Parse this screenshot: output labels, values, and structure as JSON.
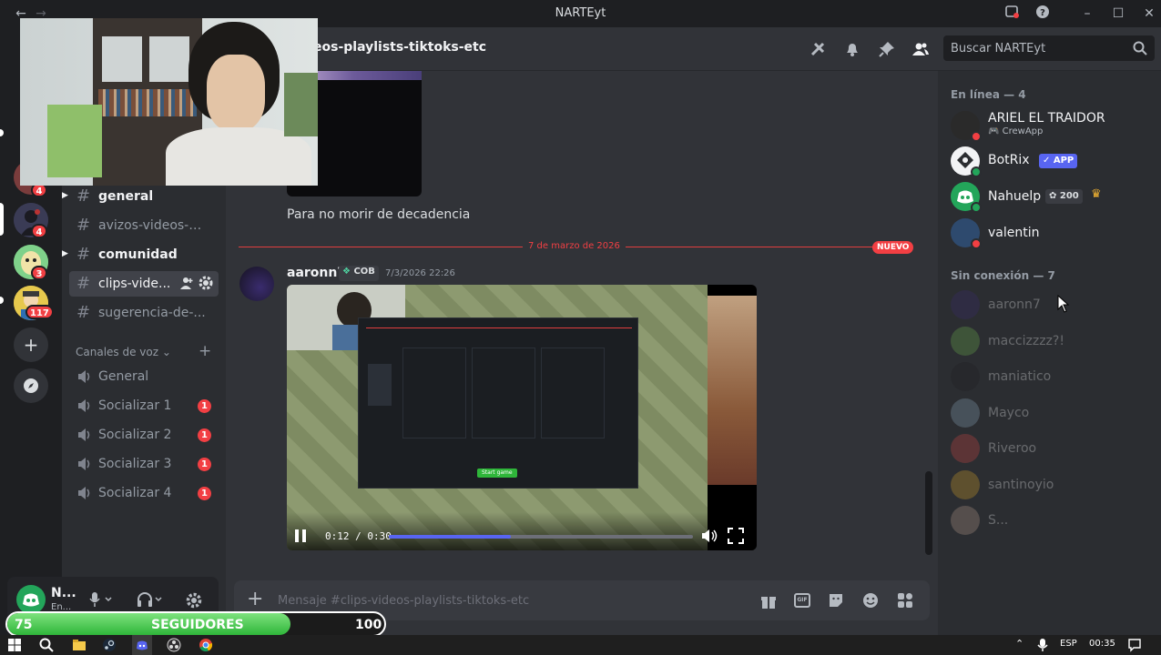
{
  "window": {
    "title": "NARTEyt"
  },
  "servers": [
    {
      "badge": "4"
    },
    {
      "badge": "4"
    },
    {
      "badge": "3"
    },
    {
      "badge": "117"
    }
  ],
  "channels": [
    {
      "name": "general"
    },
    {
      "name": "avizos-videos-s..."
    },
    {
      "name": "comunidad"
    },
    {
      "name": "clips-vide..."
    },
    {
      "name": "sugerencia-de-..."
    }
  ],
  "voice": {
    "category": "Canales de voz",
    "channels": [
      {
        "name": "General",
        "badge": ""
      },
      {
        "name": "Socializar 1",
        "badge": "1"
      },
      {
        "name": "Socializar 2",
        "badge": "1"
      },
      {
        "name": "Socializar 3",
        "badge": "1"
      },
      {
        "name": "Socializar 4",
        "badge": "1"
      }
    ]
  },
  "user_panel": {
    "name": "N...",
    "status": "En..."
  },
  "header": {
    "channel_title": "eos-playlists-tiktoks-etc"
  },
  "search": {
    "placeholder": "Buscar NARTEyt"
  },
  "chat": {
    "prev_message": "Para no morir de decadencia",
    "divider_date": "7 de marzo de 2026",
    "new_label": "NUEVO",
    "message": {
      "author": "aaronn7",
      "tag": "COB",
      "timestamp": "7/3/2026 22:26"
    },
    "video": {
      "current": "0:12",
      "duration": "0:30",
      "time_text": "0:12 / 0:30",
      "progress": 0.4,
      "inner_start": "Start game"
    }
  },
  "composer": {
    "placeholder": "Mensaje #clips-videos-playlists-tiktoks-etc"
  },
  "members": {
    "online_header": "En línea — 4",
    "online": [
      {
        "name": "ARIEL EL TRAIDOR",
        "activity": "CrewApp",
        "status": "dnd"
      },
      {
        "name": "BotRix",
        "badge": "✓ APP",
        "status": "online"
      },
      {
        "name": "Nahuelp",
        "chip": "200",
        "status": "online"
      },
      {
        "name": "valentin",
        "status": "dnd"
      }
    ],
    "offline_header": "Sin conexión — 7",
    "offline": [
      {
        "name": "aaronn7"
      },
      {
        "name": "maccizzzz?!"
      },
      {
        "name": "maniatico"
      },
      {
        "name": "Mayco"
      },
      {
        "name": "Riveroo"
      },
      {
        "name": "santinoyio"
      },
      {
        "name": "S..."
      }
    ]
  },
  "followers": {
    "current": "75",
    "label": "SEGUIDORES",
    "goal": "100",
    "fill": 0.75
  },
  "taskbar": {
    "lang": "ESP",
    "time": "00:35"
  },
  "colors": {
    "accent": "#5865f2",
    "danger": "#f23f43",
    "online": "#23a55a",
    "bg": "#313338"
  }
}
